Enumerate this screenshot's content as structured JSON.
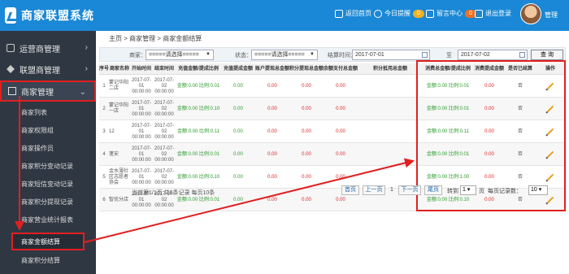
{
  "app": {
    "title": "商家联盟系统"
  },
  "topnav": {
    "home": "返回首页",
    "today": "今日提醒",
    "today_count": "0",
    "messages": "留言中心",
    "messages_count": "0",
    "logout": "退出登录",
    "username": "管理"
  },
  "sidebar": {
    "top": [
      {
        "label": "运营商管理"
      },
      {
        "label": "联盟商管理"
      },
      {
        "label": "商家管理"
      }
    ],
    "sub": [
      {
        "label": "商家列表"
      },
      {
        "label": "商家权限组"
      },
      {
        "label": "商家操作员"
      },
      {
        "label": "商家积分变动记录"
      },
      {
        "label": "商家短信变动记录"
      },
      {
        "label": "商家积分提现记录"
      },
      {
        "label": "商家营业统计报表"
      },
      {
        "label": "商家金额结算"
      },
      {
        "label": "商家积分结算"
      }
    ]
  },
  "breadcrumb": "主页 > 商家管理 > 商家金额结算",
  "filters": {
    "merchant_label": "商家：",
    "merchant_value": "=====请选择=====",
    "status_label": "状态：",
    "status_value": "=====请选择=====",
    "date_label": "结算时间：",
    "date_from": "2017-07-01",
    "to_label": "至",
    "date_to": "2017-07-02",
    "search": "查 询"
  },
  "table": {
    "headers": [
      "序号",
      "商家名称",
      "开始时间",
      "结束时间",
      "充值金额/提成比例",
      "充值提成金额",
      "账户提现总金额",
      "积分提现总金额",
      "余额支付总金额",
      "积分抵用总金额",
      "消费总金额/提成比例",
      "消费提成金额",
      "是否已结算",
      "操作"
    ],
    "rows": [
      {
        "no": "1",
        "name": "蒙记华阳二店",
        "start": "2017-07-01 00:00:00",
        "end": "2017-07-02 00:00:00",
        "charge": "金额:0.00 比例:0.01",
        "c1": "0.00",
        "c2": "0.00",
        "c3": "0.00",
        "c4": "0.00",
        "c5": "",
        "consume": "金额:0.00 比例:0.01",
        "c6": "0.00",
        "settled": "否"
      },
      {
        "no": "2",
        "name": "蒙记华阳一店",
        "start": "2017-07-01 00:00:00",
        "end": "2017-07-02 00:00:00",
        "charge": "金额:0.00 比例:0.10",
        "c1": "0.00",
        "c2": "0.00",
        "c3": "0.00",
        "c4": "0.00",
        "c5": "",
        "consume": "金额:0.00 比例:0.01",
        "c6": "0.00",
        "settled": "否"
      },
      {
        "no": "3",
        "name": "12",
        "start": "2017-07-01 00:00:00",
        "end": "2017-07-02 00:00:00",
        "charge": "金额:0.00 比例:0.11",
        "c1": "0.00",
        "c2": "0.00",
        "c3": "0.00",
        "c4": "0.00",
        "c5": "",
        "consume": "金额:0.00 比例:0.11",
        "c6": "0.00",
        "settled": "否"
      },
      {
        "no": "4",
        "name": "蓬安",
        "start": "2017-07-01 00:00:00",
        "end": "2017-07-02 00:00:00",
        "charge": "金额:0.00 比例:0.01",
        "c1": "0.00",
        "c2": "0.00",
        "c3": "0.00",
        "c4": "0.00",
        "c5": "",
        "consume": "金额:0.00 比例:0.01",
        "c6": "0.00",
        "settled": "否"
      },
      {
        "no": "5",
        "name": "金水薄社区志愿者协会",
        "start": "2017-07-01 00:00:00",
        "end": "2017-07-02 00:00:00",
        "charge": "金额:0.00 比例:0.10",
        "c1": "0.00",
        "c2": "0.00",
        "c3": "0.00",
        "c4": "0.00",
        "c5": "",
        "consume": "金额:0.00 比例:1.00",
        "c6": "0.00",
        "settled": "否"
      },
      {
        "no": "6",
        "name": "智优分店",
        "start": "2017-07-01 00:00:00",
        "end": "2017-07-02 00:00:00",
        "charge": "金额:0.00 比例:0.01",
        "c1": "0.00",
        "c2": "0.00",
        "c3": "0.00",
        "c4": "0.00",
        "c5": "",
        "consume": "金额:0.00 比例:0.10",
        "c6": "0.00",
        "settled": "否"
      }
    ]
  },
  "pager": {
    "info": "当前第1/1页 共6条记录 每页10条",
    "first": "首页",
    "prev": "上一页",
    "page": "1",
    "next": "下一页",
    "last": "尾页",
    "goto_label": "转到",
    "goto_value": "1",
    "goto_unit": "页",
    "per_page_label": "每页记录数：",
    "per_page_value": "10"
  },
  "colors": {
    "header_blue": "#1a88d6",
    "sidebar": "#2f3742",
    "highlight": "#e02020",
    "green": "#2a9a2a",
    "red": "#e02020"
  }
}
